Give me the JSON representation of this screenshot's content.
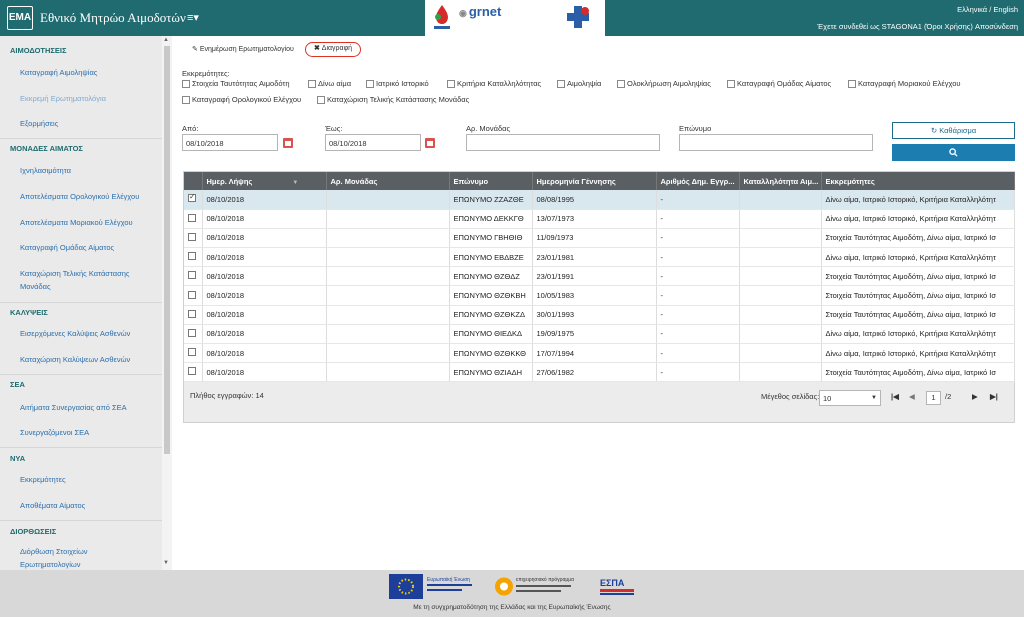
{
  "header": {
    "logo": "EMA",
    "title": "Εθνικό Μητρώο Αιμοδοτών",
    "menu_icon": "≡▾",
    "partner_logo_1": "EKEA",
    "partner_logo_2": "grnet",
    "language": "Ελληνικά / English",
    "login_info": "Έχετε συνδεθεί ως STAGONA1 (Όροι Χρήσης) Αποσύνδεση",
    "color": "#1f6b6f"
  },
  "sidebar": {
    "sections": [
      {
        "title": "ΑΙΜΟΔΟΤΗΣΕΙΣ",
        "items": [
          "Καταγραφή Αιμοληψίας",
          "Εκκρεμή Ερωτηματολόγια",
          "Εξορμήσεις"
        ]
      },
      {
        "title": "ΜΟΝΑΔΕΣ ΑΙΜΑΤΟΣ",
        "items": [
          "Ιχνηλασιμότητα",
          "Αποτελέσματα Ορολογικού Ελέγχου",
          "Αποτελέσματα Μοριακού Ελέγχου",
          "Καταγραφή Ομάδας Αίματος",
          "Καταχώριση Τελικής Κατάστασης Μονάδας"
        ]
      },
      {
        "title": "ΚΑΛΥΨΕΙΣ",
        "items": [
          "Εισερχόμενες Καλύψεις Ασθενών",
          "Καταχώριση Καλύψεων Ασθενών"
        ]
      },
      {
        "title": "ΣΕΑ",
        "items": [
          "Αιτήματα Συνεργασίας από ΣΕΑ",
          "Συνεργαζόμενοι ΣΕΑ"
        ]
      },
      {
        "title": "ΝΥΑ",
        "items": [
          "Εκκρεμότητες",
          "Αποθέματα Αίματος"
        ]
      },
      {
        "title": "ΔΙΟΡΘΩΣΕΙΣ",
        "items": [
          "Διόρθωση Στοιχείων Ερωτηματολογίων"
        ]
      }
    ]
  },
  "tabs": {
    "update": "Ενημέρωση Ερωτηματολογίου",
    "delete": "Διαγραφή"
  },
  "filters": {
    "pending_label": "Εκκρεμότητες:",
    "pending": [
      "Στοιχεία Ταυτότητας Αιμοδότη",
      "Δίνω αίμα",
      "Ιατρικό Ιστορικό",
      "Κριτήρια Καταλληλότητας",
      "Αιμοληψία",
      "Ολοκλήρωση Αιμοληψίας",
      "Καταγραφή Ομάδας Αίματος",
      "Καταγραφή Μοριακού Ελέγχου",
      "Καταγραφή Ορολογικού Ελέγχου",
      "Καταχώριση Τελικής Κατάστασης Μονάδας"
    ],
    "from_label": "Από:",
    "from_value": "08/10/2018",
    "to_label": "Έως:",
    "to_value": "08/10/2018",
    "unit_label": "Αρ. Μονάδας",
    "unit_value": "",
    "surname_label": "Επώνυμο",
    "surname_value": "",
    "clear_button": "Καθάρισμα",
    "search_icon": "search-icon"
  },
  "grid": {
    "columns": [
      "",
      "Ημερ. Λήψης",
      "Αρ. Μονάδας",
      "Επώνυμο",
      "Ημερομηνία Γέννησης",
      "Αριθμός Δημ. Εγγρ...",
      "Καταλληλότητα Αιμ...",
      "Εκκρεμότητες"
    ],
    "rows": [
      {
        "checked": true,
        "date": "08/10/2018",
        "unit": "",
        "surname": "ΕΠΩΝΥΜΟ ΖΖΑΖΘΕ",
        "birth": "08/08/1995",
        "reg": "-",
        "elig": "",
        "pending": "Δίνω αίμα, Ιατρικό Ιστορικό, Κριτήρια Καταλληλότητ"
      },
      {
        "checked": false,
        "date": "08/10/2018",
        "unit": "",
        "surname": "ΕΠΩΝΥΜΟ ΔΕΚΚΓΘ",
        "birth": "13/07/1973",
        "reg": "-",
        "elig": "",
        "pending": "Δίνω αίμα, Ιατρικό Ιστορικό, Κριτήρια Καταλληλότητ"
      },
      {
        "checked": false,
        "date": "08/10/2018",
        "unit": "",
        "surname": "ΕΠΩΝΥΜΟ ΓΒΗΘΙΘ",
        "birth": "11/09/1973",
        "reg": "-",
        "elig": "",
        "pending": "Στοιχεία Ταυτότητας Αιμοδότη, Δίνω αίμα, Ιατρικό Ισ"
      },
      {
        "checked": false,
        "date": "08/10/2018",
        "unit": "",
        "surname": "ΕΠΩΝΥΜΟ ΕΒΔΒΖΕ",
        "birth": "23/01/1981",
        "reg": "-",
        "elig": "",
        "pending": "Δίνω αίμα, Ιατρικό Ιστορικό, Κριτήρια Καταλληλότητ"
      },
      {
        "checked": false,
        "date": "08/10/2018",
        "unit": "",
        "surname": "ΕΠΩΝΥΜΟ ΘΖΘΔΖ",
        "birth": "23/01/1991",
        "reg": "-",
        "elig": "",
        "pending": "Στοιχεία Ταυτότητας Αιμοδότη, Δίνω αίμα, Ιατρικό Ισ"
      },
      {
        "checked": false,
        "date": "08/10/2018",
        "unit": "",
        "surname": "ΕΠΩΝΥΜΟ ΘΖΘΚΒΗ",
        "birth": "10/05/1983",
        "reg": "-",
        "elig": "",
        "pending": "Στοιχεία Ταυτότητας Αιμοδότη, Δίνω αίμα, Ιατρικό Ισ"
      },
      {
        "checked": false,
        "date": "08/10/2018",
        "unit": "",
        "surname": "ΕΠΩΝΥΜΟ ΘΖΘΚΖΔ",
        "birth": "30/01/1993",
        "reg": "-",
        "elig": "",
        "pending": "Στοιχεία Ταυτότητας Αιμοδότη, Δίνω αίμα, Ιατρικό Ισ"
      },
      {
        "checked": false,
        "date": "08/10/2018",
        "unit": "",
        "surname": "ΕΠΩΝΥΜΟ ΘΙΕΔΚΔ",
        "birth": "19/09/1975",
        "reg": "-",
        "elig": "",
        "pending": "Δίνω αίμα, Ιατρικό Ιστορικό, Κριτήρια Καταλληλότητ"
      },
      {
        "checked": false,
        "date": "08/10/2018",
        "unit": "",
        "surname": "ΕΠΩΝΥΜΟ ΘΖΘΚΚΘ",
        "birth": "17/07/1994",
        "reg": "-",
        "elig": "",
        "pending": "Δίνω αίμα, Ιατρικό Ιστορικό, Κριτήρια Καταλληλότητ"
      },
      {
        "checked": false,
        "date": "08/10/2018",
        "unit": "",
        "surname": "ΕΠΩΝΥΜΟ ΘΖΙΑΔΗ",
        "birth": "27/06/1982",
        "reg": "-",
        "elig": "",
        "pending": "Στοιχεία Ταυτότητας Αιμοδότη, Δίνω αίμα, Ιατρικό Ισ"
      }
    ],
    "record_count": "Πλήθος εγγραφών: 14",
    "page_size_label": "Μέγεθος σελίδας:",
    "page_size": "10",
    "page_current": "1",
    "page_total": "/2"
  },
  "footer": {
    "eu_logo": "Ευρωπαϊκή Ένωση",
    "mid_logo": "επιχειρησιακό πρόγραμμα",
    "espa_logo": "ΕΣΠΑ",
    "text": "Με τη συγχρηματοδότηση της Ελλάδας και της Ευρωπαϊκής Ένωσης"
  }
}
